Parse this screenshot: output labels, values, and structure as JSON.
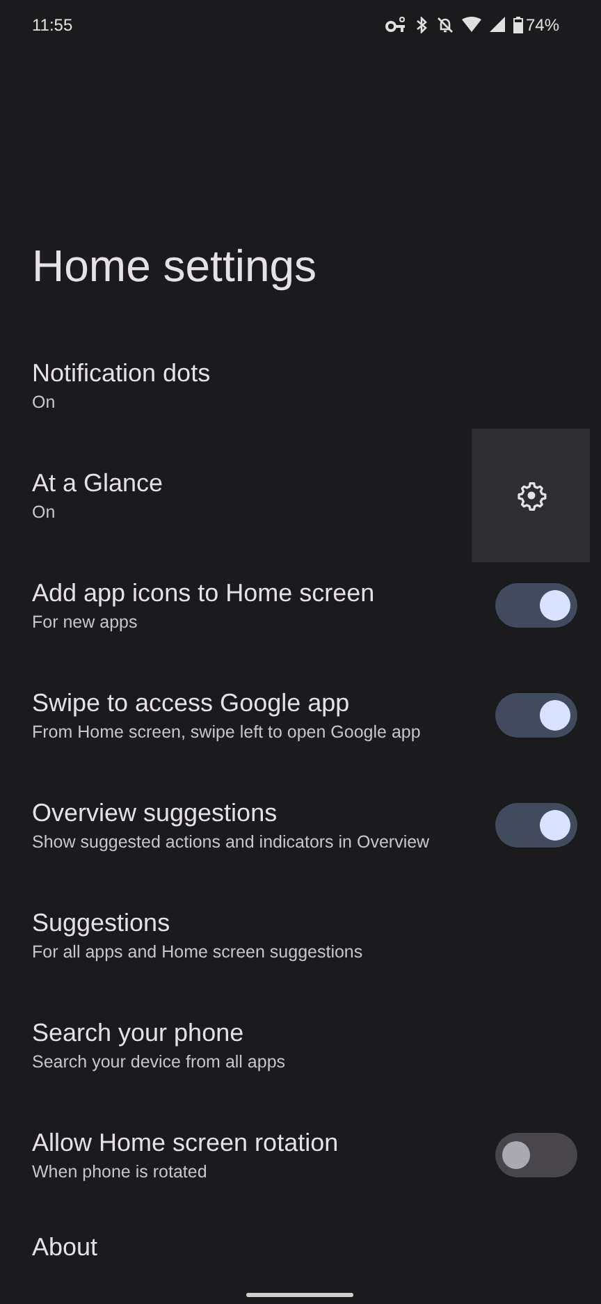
{
  "status_bar": {
    "time": "11:55",
    "battery": "74%"
  },
  "title": "Home settings",
  "items": [
    {
      "kind": "plain",
      "title": "Notification dots",
      "summary": "On"
    },
    {
      "kind": "gear",
      "title": "At a Glance",
      "summary": "On"
    },
    {
      "kind": "switch",
      "title": "Add app icons to Home screen",
      "summary": "For new apps",
      "on": true
    },
    {
      "kind": "switch",
      "title": "Swipe to access Google app",
      "summary": "From Home screen, swipe left to open Google app",
      "on": true
    },
    {
      "kind": "switch",
      "title": "Overview suggestions",
      "summary": "Show suggested actions and indicators in Overview",
      "on": true
    },
    {
      "kind": "plain",
      "title": "Suggestions",
      "summary": "For all apps and Home screen suggestions"
    },
    {
      "kind": "plain",
      "title": "Search your phone",
      "summary": "Search your device from all apps"
    },
    {
      "kind": "switch",
      "title": "Allow Home screen rotation",
      "summary": "When phone is rotated",
      "on": false
    },
    {
      "kind": "plain",
      "title": "About"
    }
  ]
}
